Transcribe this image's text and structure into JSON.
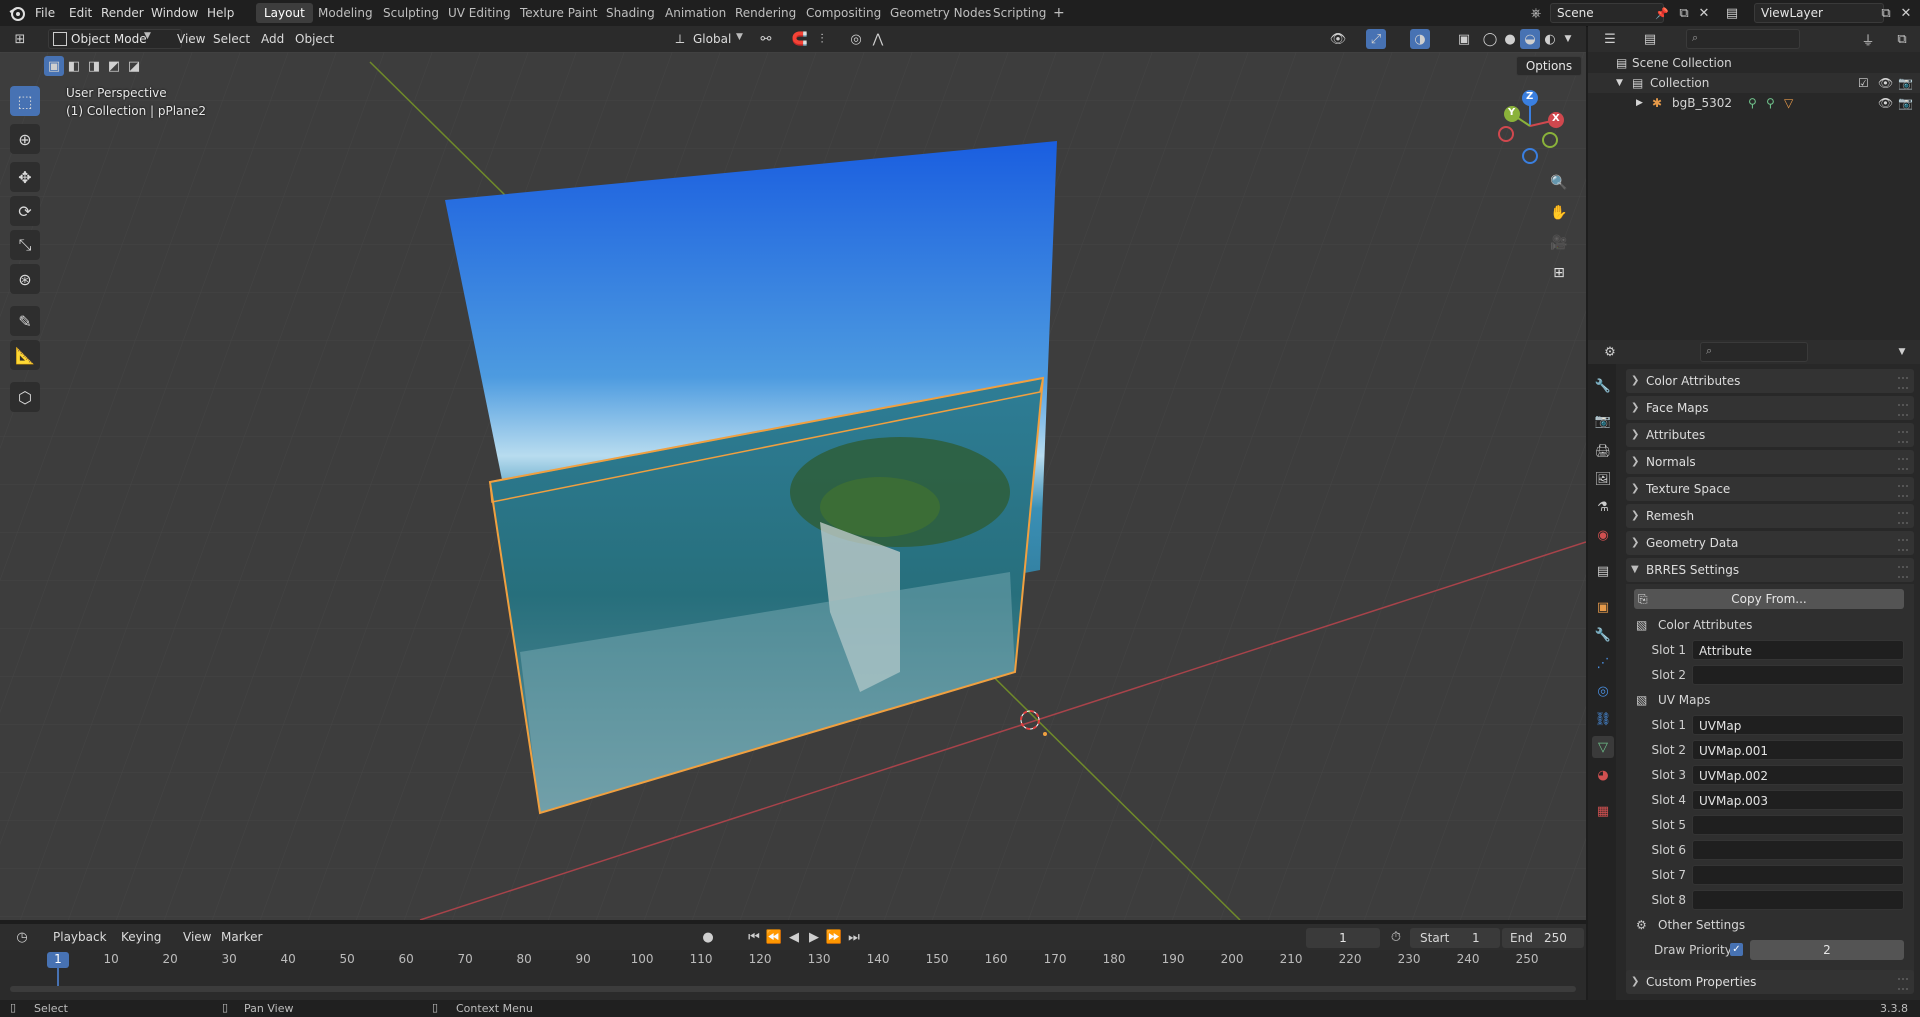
{
  "topbar": {
    "menus": [
      "File",
      "Edit",
      "Render",
      "Window",
      "Help"
    ],
    "workspaces": [
      "Layout",
      "Modeling",
      "Sculpting",
      "UV Editing",
      "Texture Paint",
      "Shading",
      "Animation",
      "Rendering",
      "Compositing",
      "Geometry Nodes",
      "Scripting"
    ],
    "active_workspace": "Layout",
    "add_tab": "+",
    "scene_name": "Scene",
    "view_layer": "ViewLayer"
  },
  "viewport_header": {
    "mode": "Object Mode",
    "menus": [
      "View",
      "Select",
      "Add",
      "Object"
    ],
    "orientation": "Global",
    "options_label": "Options"
  },
  "viewport": {
    "perspective_label": "User Perspective",
    "context_label": "(1) Collection | pPlane2",
    "gizmo_axes": [
      "X",
      "Y",
      "Z"
    ]
  },
  "outliner": {
    "rows": [
      {
        "label": "Scene Collection"
      },
      {
        "label": "Collection"
      },
      {
        "label": "bgB_5302"
      }
    ]
  },
  "properties": {
    "collapsed_panels": [
      "Color Attributes",
      "Face Maps",
      "Attributes",
      "Normals",
      "Texture Space",
      "Remesh",
      "Geometry Data"
    ],
    "brres_panel": "BRRES Settings",
    "copy_from": "Copy From...",
    "color_attributes_label": "Color Attributes",
    "color_slots": [
      {
        "label": "Slot 1",
        "value": "Attribute"
      },
      {
        "label": "Slot 2",
        "value": ""
      }
    ],
    "uv_maps_label": "UV Maps",
    "uv_slots": [
      {
        "label": "Slot 1",
        "value": "UVMap"
      },
      {
        "label": "Slot 2",
        "value": "UVMap.001"
      },
      {
        "label": "Slot 3",
        "value": "UVMap.002"
      },
      {
        "label": "Slot 4",
        "value": "UVMap.003"
      },
      {
        "label": "Slot 5",
        "value": ""
      },
      {
        "label": "Slot 6",
        "value": ""
      },
      {
        "label": "Slot 7",
        "value": ""
      },
      {
        "label": "Slot 8",
        "value": ""
      }
    ],
    "other_settings_label": "Other Settings",
    "draw_priority_label": "Draw Priority",
    "draw_priority_checked": true,
    "draw_priority_value": "2",
    "custom_properties": "Custom Properties"
  },
  "timeline": {
    "menus": [
      "Playback",
      "Keying",
      "View",
      "Marker"
    ],
    "current_frame": "1",
    "start_label": "Start",
    "start_value": "1",
    "end_label": "End",
    "end_value": "250",
    "ticks": [
      "1",
      "10",
      "20",
      "30",
      "40",
      "50",
      "60",
      "70",
      "80",
      "90",
      "100",
      "110",
      "120",
      "130",
      "140",
      "150",
      "160",
      "170",
      "180",
      "190",
      "200",
      "210",
      "220",
      "230",
      "240",
      "250"
    ]
  },
  "statusbar": {
    "select": "Select",
    "pan_view": "Pan View",
    "context_menu": "Context Menu",
    "version": "3.3.8"
  },
  "colors": {
    "accent": "#4772b3",
    "selection_outline": "#f0a040",
    "x_axis": "#d0484e",
    "y_axis": "#8ab23a",
    "z_axis": "#3a7fe0"
  }
}
